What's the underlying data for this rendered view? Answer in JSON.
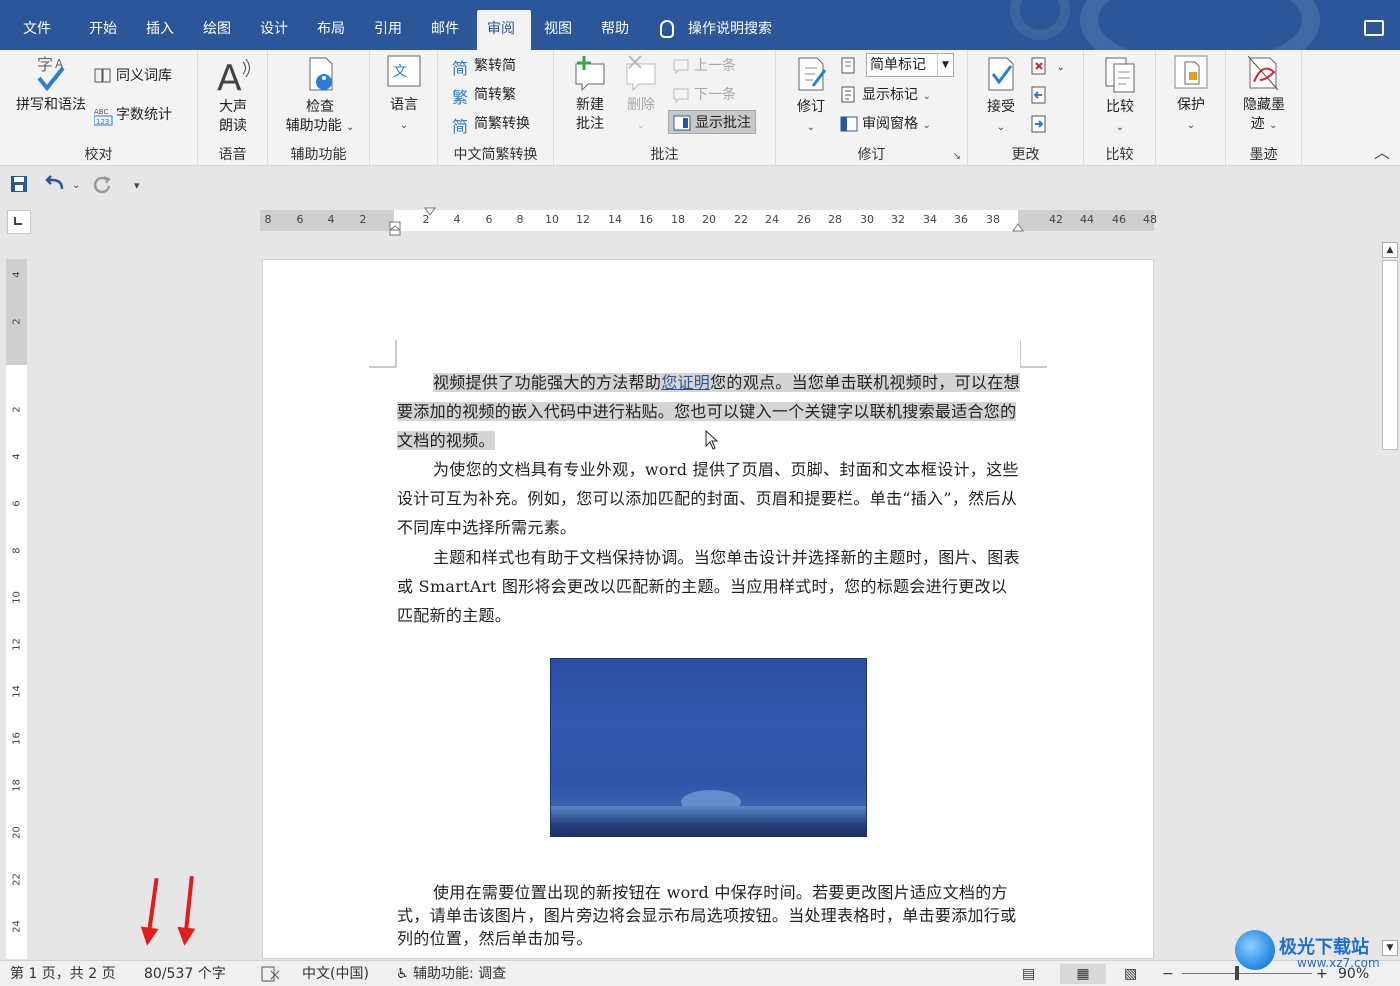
{
  "tabs": [
    "文件",
    "开始",
    "插入",
    "绘图",
    "设计",
    "布局",
    "引用",
    "邮件",
    "审阅",
    "视图",
    "帮助"
  ],
  "active_tab": "审阅",
  "tell_me": "操作说明搜索",
  "ribbon": {
    "proofing": {
      "label": "校对",
      "spelling": "拼写和语法",
      "thesaurus": "同义词库",
      "word_count": "字数统计"
    },
    "speech": {
      "label": "语音",
      "read_aloud_l1": "大声",
      "read_aloud_l2": "朗读"
    },
    "accessibility": {
      "label": "辅助功能",
      "check_l1": "检查",
      "check_l2": "辅助功能"
    },
    "language": {
      "label": "语言"
    },
    "chinese": {
      "label": "中文简繁转换",
      "t2s": "繁转简",
      "s2t": "简转繁",
      "convert": "简繁转换",
      "t2s_icon": "简",
      "s2t_icon": "繁",
      "convert_icon": "简"
    },
    "comments": {
      "label": "批注",
      "new_l1": "新建",
      "new_l2": "批注",
      "delete": "删除",
      "prev": "上一条",
      "next": "下一条",
      "show": "显示批注"
    },
    "tracking": {
      "label": "修订",
      "track": "修订",
      "markup_select": "简单标记",
      "show_markup": "显示标记",
      "review_pane": "审阅窗格"
    },
    "changes": {
      "label": "更改",
      "accept": "接受"
    },
    "compare": {
      "label": "比较",
      "compare": "比较"
    },
    "protect": {
      "label": "保护",
      "protect": "保护"
    },
    "ink": {
      "label": "墨迹",
      "hide_l1": "隐藏墨",
      "hide_l2": "迹"
    }
  },
  "ruler": {
    "h_left": [
      "8",
      "6",
      "4",
      "2"
    ],
    "h_main": [
      "2",
      "4",
      "6",
      "8",
      "10",
      "12",
      "14",
      "16",
      "18",
      "20",
      "22",
      "24",
      "26",
      "28",
      "30",
      "32",
      "34",
      "36",
      "38"
    ],
    "h_right": [
      "42",
      "44",
      "46",
      "48"
    ],
    "v_top": [
      "4",
      "2"
    ],
    "v_main": [
      "2",
      "4",
      "6",
      "8",
      "10",
      "12",
      "14",
      "16",
      "18",
      "20",
      "22",
      "24"
    ]
  },
  "document": {
    "p1_pre": "视频提供了功能强大的方法帮助",
    "p1_link": "您证明",
    "p1_post": "您的观点。当您单击联机视频时，可以在想要添加的视频的嵌入代码中进行粘贴。您也可以键入一个关键字以联机搜索最适合您的文档的视频。",
    "p2": "为使您的文档具有专业外观，word 提供了页眉、页脚、封面和文本框设计，这些设计可互为补充。例如，您可以添加匹配的封面、页眉和提要栏。单击“插入”，然后从不同库中选择所需元素。",
    "p3": "主题和样式也有助于文档保持协调。当您单击设计并选择新的主题时，图片、图表或 SmartArt 图形将会更改以匹配新的主题。当应用样式时，您的标题会进行更改以匹配新的主题。",
    "p4": "使用在需要位置出现的新按钮在  word  中保存时间。若要更改图片适应文档的方式，请单击该图片，图片旁边将会显示布局选项按钮。当处理表格时，单击要添加行或列的位置，然后单击加号。"
  },
  "status": {
    "page": "第 1 页，共 2 页",
    "words": "80/537 个字",
    "language": "中文(中国)",
    "accessibility": "辅助功能: 调查",
    "zoom": "90%"
  },
  "watermark": {
    "text": "极光下载站",
    "url": "www.xz7.com"
  },
  "colors": {
    "accent": "#2b579a",
    "annotation_arrow": "#e31b1b"
  }
}
